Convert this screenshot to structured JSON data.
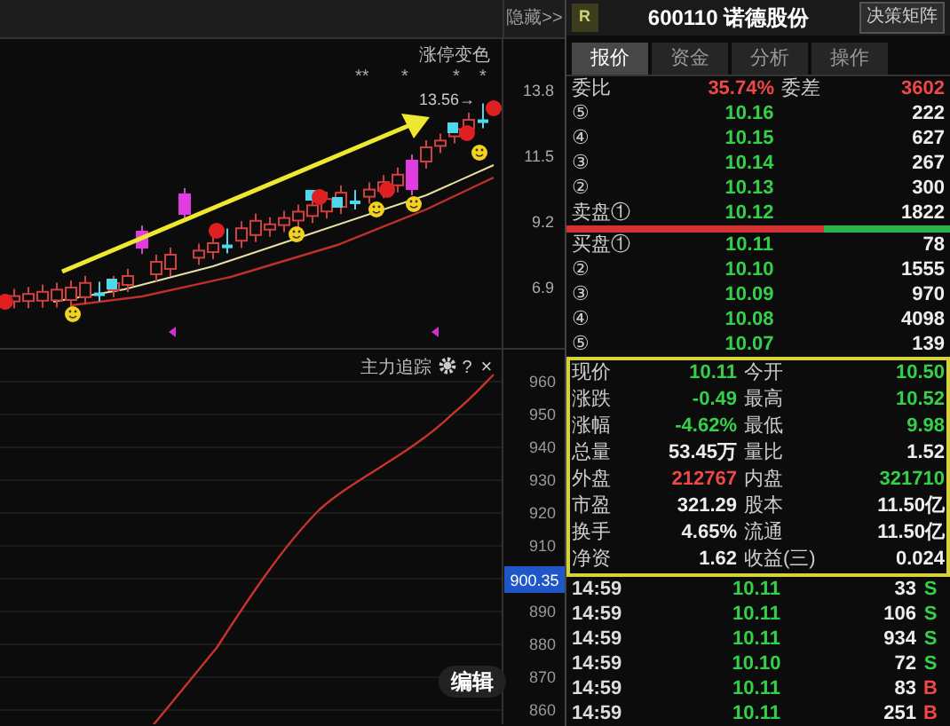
{
  "toolbar": {
    "hide_link": "隐藏>>"
  },
  "main_chart": {
    "legend": "涨停变色",
    "star_marks": [
      "**",
      "*",
      "*",
      "*"
    ],
    "last_price_label": "13.56→",
    "price_axis": [
      "13.8",
      "11.5",
      "9.2",
      "6.9"
    ]
  },
  "indicator": {
    "title": "主力追踪",
    "help_button": "?",
    "close_button": "×",
    "edit_button": "编辑",
    "value_axis": [
      "960",
      "950",
      "940",
      "930",
      "920",
      "910",
      "890",
      "880",
      "870",
      "860"
    ],
    "current_value": "900.35"
  },
  "quote_header": {
    "badge": "R",
    "code": "600110",
    "name": "诺德股份",
    "button": "决策矩阵"
  },
  "tabs": [
    {
      "label": "报价",
      "selected": true
    },
    {
      "label": "资金",
      "selected": false
    },
    {
      "label": "分析",
      "selected": false
    },
    {
      "label": "操作",
      "selected": false
    }
  ],
  "order_ratio": {
    "label": "委比",
    "value": "35.74%",
    "diff_label": "委差",
    "diff_value": "3602"
  },
  "asks": [
    {
      "label": "⑤",
      "price": "10.16",
      "volume": "222"
    },
    {
      "label": "④",
      "price": "10.15",
      "volume": "627"
    },
    {
      "label": "③",
      "price": "10.14",
      "volume": "267"
    },
    {
      "label": "②",
      "price": "10.13",
      "volume": "300"
    },
    {
      "label": "卖盘①",
      "price": "10.12",
      "volume": "1822"
    }
  ],
  "balance_bar": {
    "level": 0.67
  },
  "bids": [
    {
      "label": "买盘①",
      "price": "10.11",
      "volume": "78"
    },
    {
      "label": "②",
      "price": "10.10",
      "volume": "1555"
    },
    {
      "label": "③",
      "price": "10.09",
      "volume": "970"
    },
    {
      "label": "④",
      "price": "10.08",
      "volume": "4098"
    },
    {
      "label": "⑤",
      "price": "10.07",
      "volume": "139"
    }
  ],
  "stats": [
    {
      "label": "现价",
      "value": "10.11",
      "color": "#35d04a"
    },
    {
      "label": "今开",
      "value": "10.50",
      "color": "#35d04a"
    },
    {
      "label": "涨跌",
      "value": "-0.49",
      "color": "#35d04a"
    },
    {
      "label": "最高",
      "value": "10.52",
      "color": "#35d04a"
    },
    {
      "label": "涨幅",
      "value": "-4.62%",
      "color": "#35d04a"
    },
    {
      "label": "最低",
      "value": "9.98",
      "color": "#35d04a"
    },
    {
      "label": "总量",
      "value": "53.45万",
      "color": "#eeeeee"
    },
    {
      "label": "量比",
      "value": "1.52",
      "color": "#eeeeee"
    },
    {
      "label": "外盘",
      "value": "212767",
      "color": "#f04848"
    },
    {
      "label": "内盘",
      "value": "321710",
      "color": "#35d04a"
    },
    {
      "label": "市盈",
      "value": "321.29",
      "color": "#eeeeee"
    },
    {
      "label": "股本",
      "value": "11.50亿",
      "color": "#eeeeee"
    },
    {
      "label": "换手",
      "value": "4.65%",
      "color": "#eeeeee"
    },
    {
      "label": "流通",
      "value": "11.50亿",
      "color": "#eeeeee"
    },
    {
      "label": "净资",
      "value": "1.62",
      "color": "#eeeeee"
    },
    {
      "label": "收益(三)",
      "value": "0.024",
      "color": "#eeeeee"
    }
  ],
  "trades": [
    {
      "time": "14:59",
      "price": "10.11",
      "volume": "33",
      "side": "S",
      "color": "#35d04a"
    },
    {
      "time": "14:59",
      "price": "10.11",
      "volume": "106",
      "side": "S",
      "color": "#35d04a"
    },
    {
      "time": "14:59",
      "price": "10.11",
      "volume": "934",
      "side": "S",
      "color": "#35d04a"
    },
    {
      "time": "14:59",
      "price": "10.10",
      "volume": "72",
      "side": "S",
      "color": "#35d04a"
    },
    {
      "time": "14:59",
      "price": "10.11",
      "volume": "83",
      "side": "B",
      "color": "#f04848"
    },
    {
      "time": "14:59",
      "price": "10.11",
      "volume": "251",
      "side": "B",
      "color": "#f04848"
    }
  ]
}
